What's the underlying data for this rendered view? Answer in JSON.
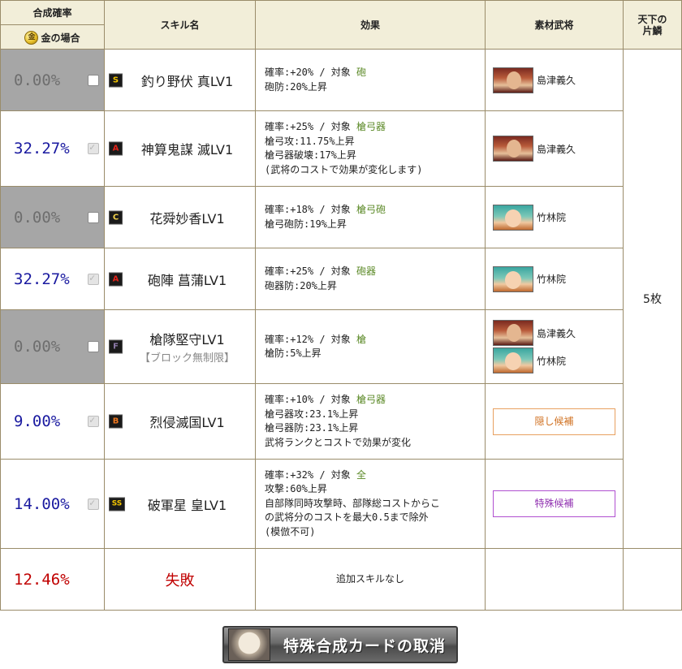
{
  "header": {
    "rate_title": "合成確率",
    "gold_case": "金の場合",
    "gold_coin": "金",
    "skill_name": "スキル名",
    "effect": "効果",
    "material": "素材武将",
    "scale_title_1": "天下の",
    "scale_title_2": "片鱗"
  },
  "rows": [
    {
      "rate": "0.00%",
      "rank": "S",
      "skill": "釣り野伏 真LV1",
      "line1_a": "確率:+20%  /  対象 ",
      "line1_t": "砲",
      "lines": [
        "砲防:20%上昇"
      ],
      "generals": [
        "島津義久"
      ]
    },
    {
      "rate": "32.27%",
      "rank": "A",
      "skill": "神算鬼謀 滅LV1",
      "line1_a": "確率:+25%  /  対象 ",
      "line1_t": "槍弓器",
      "lines": [
        "槍弓攻:11.75%上昇",
        "槍弓器破壊:17%上昇",
        "(武将のコストで効果が変化します)"
      ],
      "generals": [
        "島津義久"
      ]
    },
    {
      "rate": "0.00%",
      "rank": "C",
      "skill": "花舜妙香LV1",
      "line1_a": "確率:+18%  /  対象 ",
      "line1_t": "槍弓砲",
      "lines": [
        "槍弓砲防:19%上昇"
      ],
      "generals": [
        "竹林院"
      ]
    },
    {
      "rate": "32.27%",
      "rank": "A",
      "skill": "砲陣 菖蒲LV1",
      "line1_a": "確率:+25%  /  対象 ",
      "line1_t": "砲器",
      "lines": [
        "砲器防:20%上昇"
      ],
      "generals": [
        "竹林院"
      ]
    },
    {
      "rate": "0.00%",
      "rank": "F",
      "skill": "槍隊堅守LV1",
      "sub": "【ブロック無制限】",
      "line1_a": "確率:+12%  /  対象 ",
      "line1_t": "槍",
      "lines": [
        "槍防:5%上昇"
      ],
      "generals": [
        "島津義久",
        "竹林院"
      ]
    },
    {
      "rate": "9.00%",
      "rank": "B",
      "skill": "烈侵滅国LV1",
      "line1_a": "確率:+10%  /  対象 ",
      "line1_t": "槍弓器",
      "lines": [
        "槍弓器攻:23.1%上昇",
        "槍弓器防:23.1%上昇",
        "武将ランクとコストで効果が変化"
      ],
      "candidate": "隠し候補"
    },
    {
      "rate": "14.00%",
      "rank": "SS",
      "skill": "破軍星 皇LV1",
      "line1_a": "確率:+32%  /  対象 ",
      "line1_t": "全",
      "lines": [
        "攻撃:60%上昇",
        "自部隊同時攻撃時、部隊総コストからこ",
        "の武将分のコストを最大0.5まで除外",
        "(模倣不可)"
      ],
      "candidate": "特殊候補"
    }
  ],
  "fail": {
    "rate": "12.46%",
    "label": "失敗",
    "effect": "追加スキルなし"
  },
  "scale_value": "5枚",
  "cancel_button": "特殊合成カードの取消"
}
